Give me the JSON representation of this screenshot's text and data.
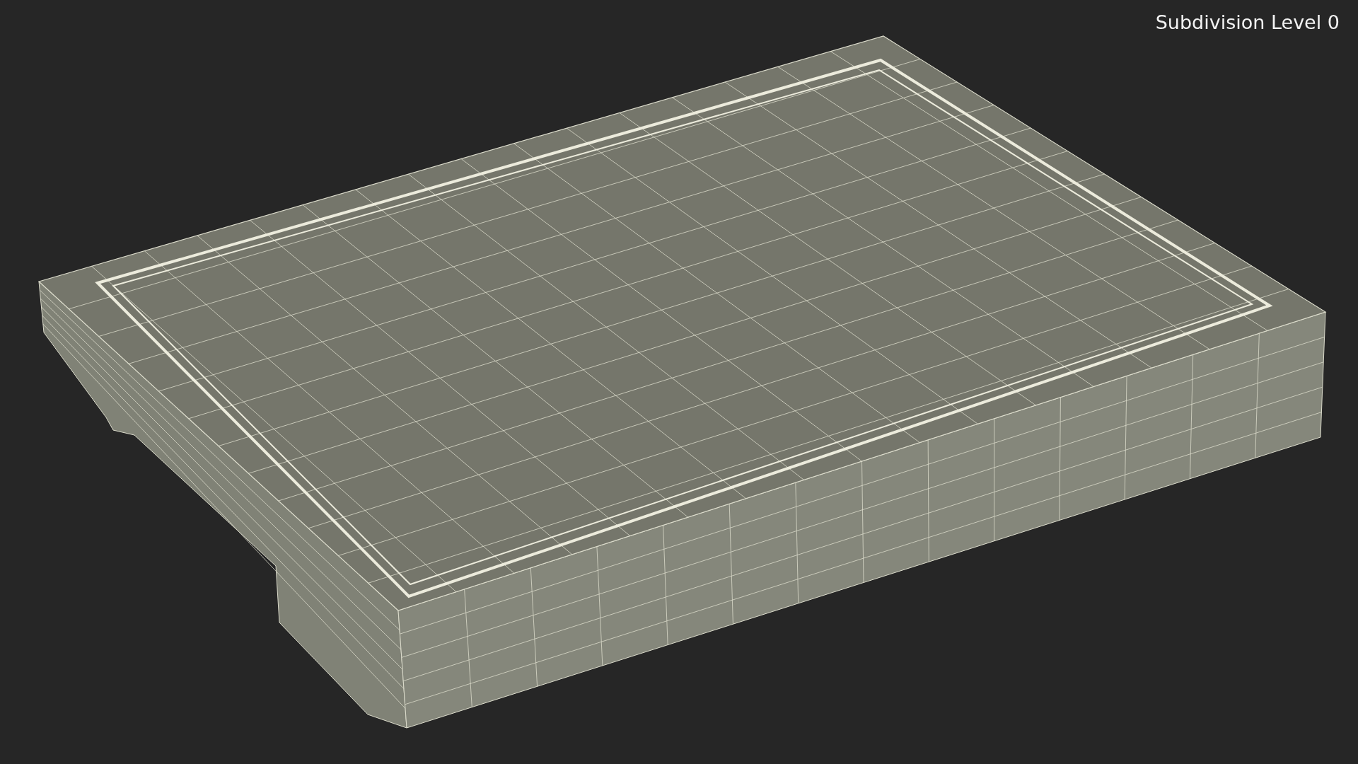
{
  "viewport": {
    "label": "Subdivision Level 0"
  }
}
